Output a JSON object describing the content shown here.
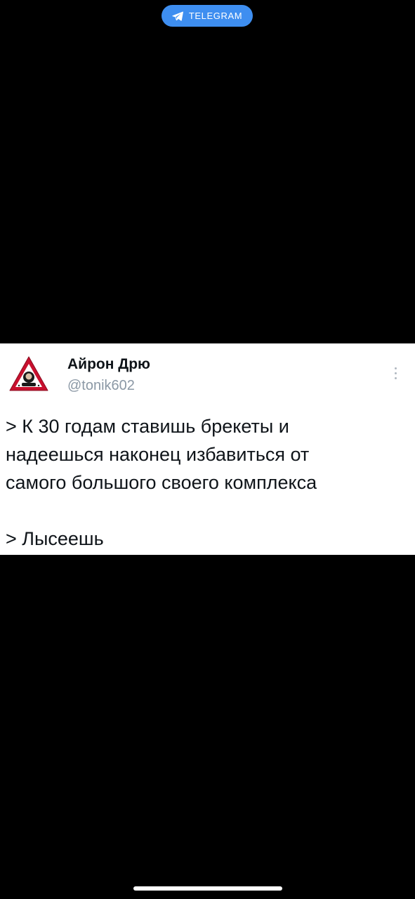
{
  "header": {
    "badge_label": "TELEGRAM",
    "badge_icon": "paper-plane-icon",
    "badge_color": "#3e8ef0"
  },
  "tweet": {
    "author_name": "Айрон Дрю",
    "author_handle": "@tonik602",
    "avatar_icon": "warning-triangle-avatar",
    "more_icon": "vertical-ellipsis-icon",
    "lines": [
      "> К 30 годам ставишь брекеты и",
      "надеешься наконец избавиться от",
      "самого большого своего комплекса"
    ],
    "punchline": "> Лысеешь"
  },
  "colors": {
    "background": "#000000",
    "card": "#ffffff",
    "text": "#0f1419",
    "handle": "#8b98a5"
  }
}
